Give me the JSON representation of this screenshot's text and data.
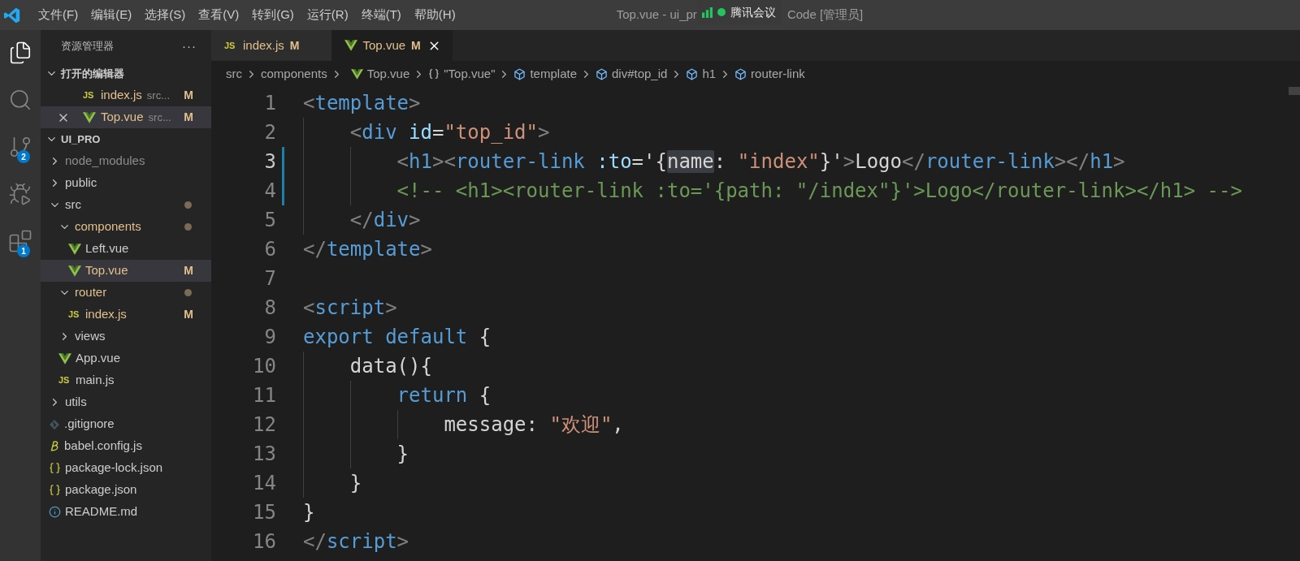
{
  "window": {
    "title_before": "Top.vue - ui_pr",
    "title_after": "Code [管理员]"
  },
  "meeting_overlay": {
    "label": "腾讯会议"
  },
  "menu": [
    "文件(F)",
    "编辑(E)",
    "选择(S)",
    "查看(V)",
    "转到(G)",
    "运行(R)",
    "终端(T)",
    "帮助(H)"
  ],
  "activity_bar": [
    {
      "kind": "explorer",
      "selected": true
    },
    {
      "kind": "search",
      "selected": false
    },
    {
      "kind": "scm",
      "selected": false,
      "badge": "2"
    },
    {
      "kind": "debug",
      "selected": false
    },
    {
      "kind": "extensions",
      "selected": false,
      "badge": "1"
    }
  ],
  "sidebar": {
    "title": "资源管理器",
    "more": "···",
    "open_editors": {
      "title": "打开的编辑器",
      "expanded": true,
      "items": [
        {
          "name": "index.js",
          "kind": "js",
          "icon_text": "JS",
          "path": "src...",
          "badge": "M",
          "modified": true,
          "selected": false
        },
        {
          "name": "Top.vue",
          "kind": "vue",
          "path": "src...",
          "badge": "M",
          "modified": true,
          "selected": true
        }
      ]
    },
    "project": {
      "title": "UI_PRO",
      "expanded": true,
      "items": [
        {
          "name": "node_modules",
          "kind": "folder",
          "expanded": false,
          "ignored": true,
          "dot": false,
          "selected": false
        },
        {
          "name": "public",
          "kind": "folder",
          "expanded": false,
          "ignored": false,
          "modified": false,
          "dot": false,
          "selected": false
        },
        {
          "name": "src",
          "kind": "folder",
          "expanded": true,
          "ignored": false,
          "modified": false,
          "dot": true,
          "selected": false,
          "children": [
            {
              "name": "components",
              "kind": "folder",
              "expanded": true,
              "ignored": false,
              "modified": true,
              "dot": true,
              "selected": false,
              "children": [
                {
                  "name": "Left.vue",
                  "kind": "vue",
                  "ignored": false,
                  "modified": false,
                  "selected": false
                },
                {
                  "name": "Top.vue",
                  "kind": "vue",
                  "ignored": false,
                  "modified": true,
                  "badge": "M",
                  "selected": true
                }
              ]
            },
            {
              "name": "router",
              "kind": "folder",
              "expanded": true,
              "ignored": false,
              "modified": true,
              "dot": true,
              "selected": false,
              "children": [
                {
                  "name": "index.js",
                  "kind": "js",
                  "icon_text": "JS",
                  "ignored": false,
                  "modified": true,
                  "badge": "M",
                  "selected": false
                }
              ]
            },
            {
              "name": "views",
              "kind": "folder",
              "expanded": false,
              "ignored": false,
              "modified": false,
              "dot": false,
              "selected": false
            },
            {
              "name": "App.vue",
              "kind": "vue",
              "ignored": false,
              "modified": false,
              "selected": false
            },
            {
              "name": "main.js",
              "kind": "js",
              "icon_text": "JS",
              "ignored": false,
              "modified": false,
              "selected": false
            }
          ]
        },
        {
          "name": "utils",
          "kind": "folder",
          "expanded": false,
          "ignored": false,
          "modified": false,
          "dot": false,
          "selected": false
        },
        {
          "name": ".gitignore",
          "kind": "git",
          "ignored": false,
          "modified": false,
          "selected": false
        },
        {
          "name": "babel.config.js",
          "kind": "babel",
          "ignored": false,
          "modified": false,
          "selected": false
        },
        {
          "name": "package-lock.json",
          "kind": "json",
          "ignored": false,
          "modified": false,
          "selected": false
        },
        {
          "name": "package.json",
          "kind": "json",
          "ignored": false,
          "modified": false,
          "selected": false
        },
        {
          "name": "README.md",
          "kind": "info",
          "ignored": false,
          "modified": false,
          "selected": false
        }
      ]
    }
  },
  "tabs": [
    {
      "label": "index.js",
      "kind": "js",
      "icon_text": "JS",
      "badge": "M",
      "selected": false
    },
    {
      "label": "Top.vue",
      "kind": "vue",
      "badge": "M",
      "selected": true
    }
  ],
  "breadcrumbs": [
    {
      "label": "src",
      "kind": "folder"
    },
    {
      "label": "components",
      "kind": "folder"
    },
    {
      "label": "Top.vue",
      "kind": "vue"
    },
    {
      "label": "\"Top.vue\"",
      "kind": "braces"
    },
    {
      "label": "template",
      "kind": "symbol"
    },
    {
      "label": "div#top_id",
      "kind": "symbol"
    },
    {
      "label": "h1",
      "kind": "symbol"
    },
    {
      "label": "router-link",
      "kind": "symbol"
    }
  ],
  "code": [
    {
      "number": "1",
      "current": false,
      "changed": false,
      "tokens": [
        {
          "kind": "punct",
          "text": "<"
        },
        {
          "kind": "tag",
          "text": "template"
        },
        {
          "kind": "punct",
          "text": ">"
        }
      ]
    },
    {
      "number": "2",
      "current": false,
      "changed": false,
      "tokens": [
        {
          "kind": "punct",
          "text": "    <"
        },
        {
          "kind": "tag",
          "text": "div"
        },
        {
          "kind": "attr",
          "text": " id"
        },
        {
          "kind": "text",
          "text": "="
        },
        {
          "kind": "str",
          "text": "\"top_id\""
        },
        {
          "kind": "punct",
          "text": ">"
        }
      ]
    },
    {
      "number": "3",
      "current": true,
      "changed": true,
      "tokens": [
        {
          "kind": "punct",
          "text": "        <"
        },
        {
          "kind": "tag",
          "text": "h1"
        },
        {
          "kind": "punct",
          "text": "><"
        },
        {
          "kind": "tag",
          "text": "router-link"
        },
        {
          "kind": "attr",
          "text": " :to"
        },
        {
          "kind": "text",
          "text": "='{"
        },
        {
          "kind": "match",
          "text": "name"
        },
        {
          "kind": "text",
          "text": ": "
        },
        {
          "kind": "str",
          "text": "\"index\""
        },
        {
          "kind": "text",
          "text": "}'"
        },
        {
          "kind": "punct",
          "text": ">"
        },
        {
          "kind": "text",
          "text": "Logo"
        },
        {
          "kind": "punct",
          "text": "</"
        },
        {
          "kind": "tag",
          "text": "router-link"
        },
        {
          "kind": "punct",
          "text": "></"
        },
        {
          "kind": "tag",
          "text": "h1"
        },
        {
          "kind": "punct",
          "text": ">"
        }
      ]
    },
    {
      "number": "4",
      "current": false,
      "changed": true,
      "tokens": [
        {
          "kind": "comment",
          "text": "        <!-- <h1><router-link :to='{path: \"/index\"}'>Logo</router-link></h1> -->"
        }
      ]
    },
    {
      "number": "5",
      "current": false,
      "changed": false,
      "tokens": [
        {
          "kind": "punct",
          "text": "    </"
        },
        {
          "kind": "tag",
          "text": "div"
        },
        {
          "kind": "punct",
          "text": ">"
        }
      ]
    },
    {
      "number": "6",
      "current": false,
      "changed": false,
      "tokens": [
        {
          "kind": "punct",
          "text": "</"
        },
        {
          "kind": "tag",
          "text": "template"
        },
        {
          "kind": "punct",
          "text": ">"
        }
      ]
    },
    {
      "number": "7",
      "current": false,
      "changed": false
    },
    {
      "number": "8",
      "current": false,
      "changed": false,
      "tokens": [
        {
          "kind": "punct",
          "text": "<"
        },
        {
          "kind": "tag",
          "text": "script"
        },
        {
          "kind": "punct",
          "text": ">"
        }
      ]
    },
    {
      "number": "9",
      "current": false,
      "changed": false,
      "tokens": [
        {
          "kind": "keyword",
          "text": "export default"
        },
        {
          "kind": "text",
          "text": " {"
        }
      ]
    },
    {
      "number": "10",
      "current": false,
      "changed": false,
      "tokens": [
        {
          "kind": "text",
          "text": "    data(){"
        }
      ]
    },
    {
      "number": "11",
      "current": false,
      "changed": false,
      "tokens": [
        {
          "kind": "keyword",
          "text": "        return"
        },
        {
          "kind": "text",
          "text": " {"
        }
      ]
    },
    {
      "number": "12",
      "current": false,
      "changed": false,
      "tokens": [
        {
          "kind": "text",
          "text": "            message: "
        },
        {
          "kind": "str",
          "text": "\"欢迎\""
        },
        {
          "kind": "text",
          "text": ","
        }
      ]
    },
    {
      "number": "13",
      "current": false,
      "changed": false,
      "tokens": [
        {
          "kind": "text",
          "text": "        }"
        }
      ]
    },
    {
      "number": "14",
      "current": false,
      "changed": false,
      "tokens": [
        {
          "kind": "text",
          "text": "    }"
        }
      ]
    },
    {
      "number": "15",
      "current": false,
      "changed": false,
      "tokens": [
        {
          "kind": "text",
          "text": "}"
        }
      ]
    },
    {
      "number": "16",
      "current": false,
      "changed": false,
      "tokens": [
        {
          "kind": "punct",
          "text": "</"
        },
        {
          "kind": "tag",
          "text": "script"
        },
        {
          "kind": "punct",
          "text": ">"
        }
      ]
    }
  ]
}
